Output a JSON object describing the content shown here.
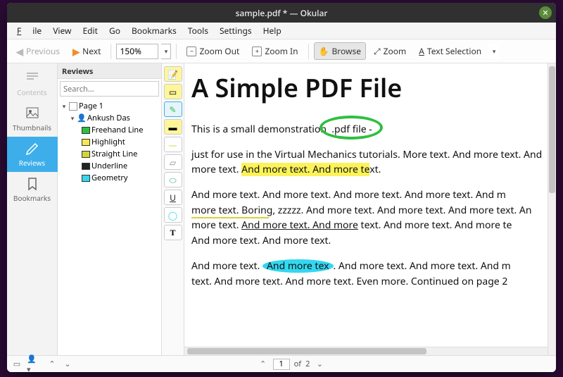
{
  "window": {
    "title": "sample.pdf * — Okular"
  },
  "menu": {
    "file": "File",
    "view": "View",
    "edit": "Edit",
    "go": "Go",
    "bookmarks": "Bookmarks",
    "tools": "Tools",
    "settings": "Settings",
    "help": "Help"
  },
  "toolbar": {
    "previous": "Previous",
    "next": "Next",
    "zoom_value": "150%",
    "zoom_out": "Zoom Out",
    "zoom_in": "Zoom In",
    "browse": "Browse",
    "zoom": "Zoom",
    "text_selection": "Text Selection"
  },
  "leftpanel": {
    "contents": "Contents",
    "thumbnails": "Thumbnails",
    "reviews": "Reviews",
    "bookmarks": "Bookmarks"
  },
  "reviews": {
    "title": "Reviews",
    "search_placeholder": "Search...",
    "tree": {
      "page": "Page 1",
      "author": "Ankush Das",
      "items": [
        {
          "label": "Freehand Line",
          "color": "#2fbf3f"
        },
        {
          "label": "Highlight",
          "color": "#f5e84e"
        },
        {
          "label": "Straight Line",
          "color": "#d4d43a"
        },
        {
          "label": "Underline",
          "color": "#222222"
        },
        {
          "label": "Geometry",
          "color": "#33d7f0"
        }
      ]
    }
  },
  "document": {
    "title": "A Simple PDF File",
    "para1_a": "This is a small demonstration",
    "para1_b": ".pdf file -",
    "para2_a": "just for use in the Virtual Mechanics tutorials. More text. And more text. And more text. ",
    "para2_hl": "And more text. And more te",
    "para2_c": "xt.",
    "para3_a": "And more text. And more text. And more text. And more text. And m",
    "para3_b": "more text. Boring, zzzzz. And more text. And more text. And more text. An",
    "para3_c": "more text. ",
    "para3_ul": "And more text. And more",
    "para3_d": " text. And more text. And more te",
    "para3_e": "And more text. And more text.",
    "para4_a": "And more text. ",
    "para4_oval": "And more tex",
    "para4_b": ". And more text. And more text. And m",
    "para4_c": "text. And more text. And more text. Even more. Continued on page 2"
  },
  "status": {
    "current_page": "1",
    "of": "of",
    "total_pages": "2"
  }
}
